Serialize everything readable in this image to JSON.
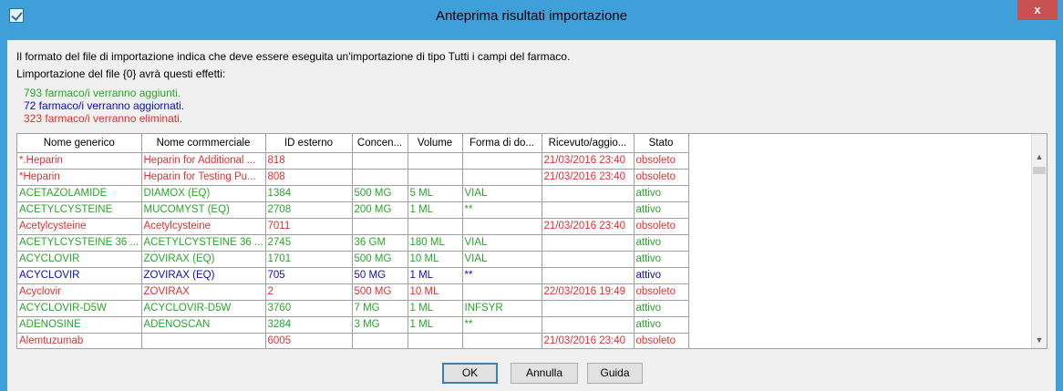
{
  "window": {
    "title": "Anteprima risultati importazione",
    "close_label": "x"
  },
  "messages": {
    "format_info": "Il formato del file di importazione indica che deve essere eseguita un'importazione di tipo Tutti i campi del farmaco.",
    "effects_intro": "Limportazione del file {0} avrà questi effetti:",
    "added": "793 farmaco/i verranno aggiunti.",
    "updated": "72 farmaco/i verranno aggiornati.",
    "deleted": "323 farmaco/i verranno eliminati."
  },
  "colors": {
    "added": "#2aa52a",
    "updated": "#0b0bc8",
    "deleted": "#e23030",
    "title_bar": "#3fa0d9",
    "close_button": "#c75050"
  },
  "grid": {
    "columns": [
      "Nome generico",
      "Nome cormmerciale",
      "ID esterno",
      "Concen...",
      "Volume",
      "Forma di do...",
      "Ricevuto/aggio...",
      "Stato"
    ],
    "rows": [
      {
        "state": "deleted",
        "cells": [
          "*.Heparin",
          "Heparin for Additional ...",
          "818",
          "",
          "",
          "",
          "21/03/2016 23:40",
          "obsoleto"
        ]
      },
      {
        "state": "deleted",
        "cells": [
          "*Heparin",
          "Heparin for Testing Pu...",
          "808",
          "",
          "",
          "",
          "21/03/2016 23:40",
          "obsoleto"
        ]
      },
      {
        "state": "added",
        "cells": [
          "ACETAZOLAMIDE",
          "DIAMOX (EQ)",
          "1384",
          "500 MG",
          "5 ML",
          "VIAL",
          "",
          "attivo"
        ]
      },
      {
        "state": "added",
        "cells": [
          "ACETYLCYSTEINE",
          "MUCOMYST (EQ)",
          "2708",
          "200 MG",
          "1 ML",
          "**",
          "",
          "attivo"
        ]
      },
      {
        "state": "deleted",
        "cells": [
          "Acetylcysteine",
          "Acetylcysteine",
          "7011",
          "",
          "",
          "",
          "21/03/2016 23:40",
          "obsoleto"
        ]
      },
      {
        "state": "added",
        "cells": [
          "ACETYLCYSTEINE 36 ...",
          "ACETYLCYSTEINE 36 ...",
          "2745",
          "36 GM",
          "180 ML",
          "VIAL",
          "",
          "attivo"
        ]
      },
      {
        "state": "added",
        "cells": [
          "ACYCLOVIR",
          "ZOVIRAX (EQ)",
          "1701",
          "500 MG",
          "10 ML",
          "VIAL",
          "",
          "attivo"
        ]
      },
      {
        "state": "updated",
        "cells": [
          "ACYCLOVIR",
          "ZOVIRAX (EQ)",
          "705",
          "50 MG",
          "1 ML",
          "**",
          "",
          "attivo"
        ]
      },
      {
        "state": "deleted",
        "cells": [
          "Acyclovir",
          "ZOVIRAX",
          "2",
          "500 MG",
          "10 ML",
          "",
          "22/03/2016 19:49",
          "obsoleto"
        ]
      },
      {
        "state": "added",
        "cells": [
          "ACYCLOVIR-D5W",
          "ACYCLOVIR-D5W",
          "3760",
          "7 MG",
          "1 ML",
          "INFSYR",
          "",
          "attivo"
        ]
      },
      {
        "state": "added",
        "cells": [
          "ADENOSINE",
          "ADENOSCAN",
          "3284",
          "3 MG",
          "1 ML",
          "**",
          "",
          "attivo"
        ]
      },
      {
        "state": "deleted",
        "cells": [
          "Alemtuzumab",
          "",
          "6005",
          "",
          "",
          "",
          "21/03/2016 23:40",
          "obsoleto"
        ]
      }
    ]
  },
  "scrollbar": {
    "up_icon": "chevron-up-icon",
    "down_icon": "chevron-down-icon"
  },
  "buttons": {
    "ok": "OK",
    "cancel": "Annulla",
    "help": "Guida"
  }
}
